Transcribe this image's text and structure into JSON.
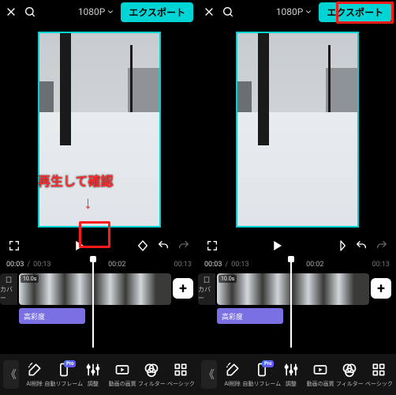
{
  "topbar": {
    "resolution": "1080P",
    "export_label": "エクスポート"
  },
  "annotations": {
    "play_confirm": "再生して確認",
    "arrow": "↓"
  },
  "time": {
    "current": "00:03",
    "total": "00:13",
    "playhead": "00:02",
    "small_total": "00:13"
  },
  "timeline": {
    "cover_line1": "囗",
    "cover_line2": "カバー",
    "clip_tag": "10.0s",
    "effect_label": "高彩度"
  },
  "tools": {
    "ai_delete": "AI削除",
    "auto_reframe": "自動リフレーム",
    "adjust": "調整",
    "video_quality": "動画の画質",
    "filter": "フィルター",
    "basic": "ベーシック",
    "pro_badge": "Pro"
  }
}
